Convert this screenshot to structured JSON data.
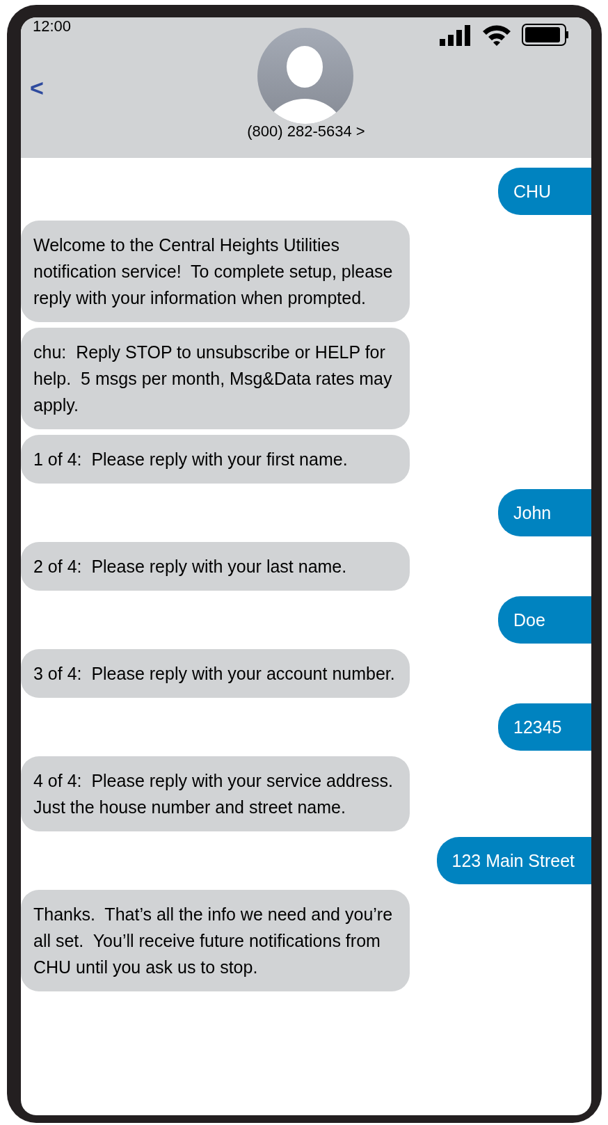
{
  "status_bar": {
    "time": "12:00"
  },
  "header": {
    "back": "<",
    "contact": "(800) 282-5634 >"
  },
  "messages": [
    {
      "kind": "sent",
      "text": "CHU"
    },
    {
      "kind": "received",
      "text": "Welcome to the Central Heights Utilities notification service!  To complete setup, please reply with your information when prompted."
    },
    {
      "kind": "received",
      "text": "chu:  Reply STOP to unsubscribe or HELP for help.  5 msgs per month, Msg&Data rates may apply."
    },
    {
      "kind": "received",
      "text": "1 of 4:  Please reply with your first name."
    },
    {
      "kind": "sent",
      "text": "John"
    },
    {
      "kind": "received",
      "text": "2 of 4:  Please reply with your last name."
    },
    {
      "kind": "sent",
      "text": "Doe"
    },
    {
      "kind": "received",
      "text": "3 of 4:  Please reply with your account number."
    },
    {
      "kind": "sent",
      "text": "12345"
    },
    {
      "kind": "received",
      "text": "4 of 4:  Please reply with your service address.  Just the house number and street name."
    },
    {
      "kind": "sent",
      "text": "123 Main Street"
    },
    {
      "kind": "received",
      "text": "Thanks.  That’s all the info we need and you’re all set.  You’ll receive future notifications from CHU until you ask us to stop."
    }
  ]
}
